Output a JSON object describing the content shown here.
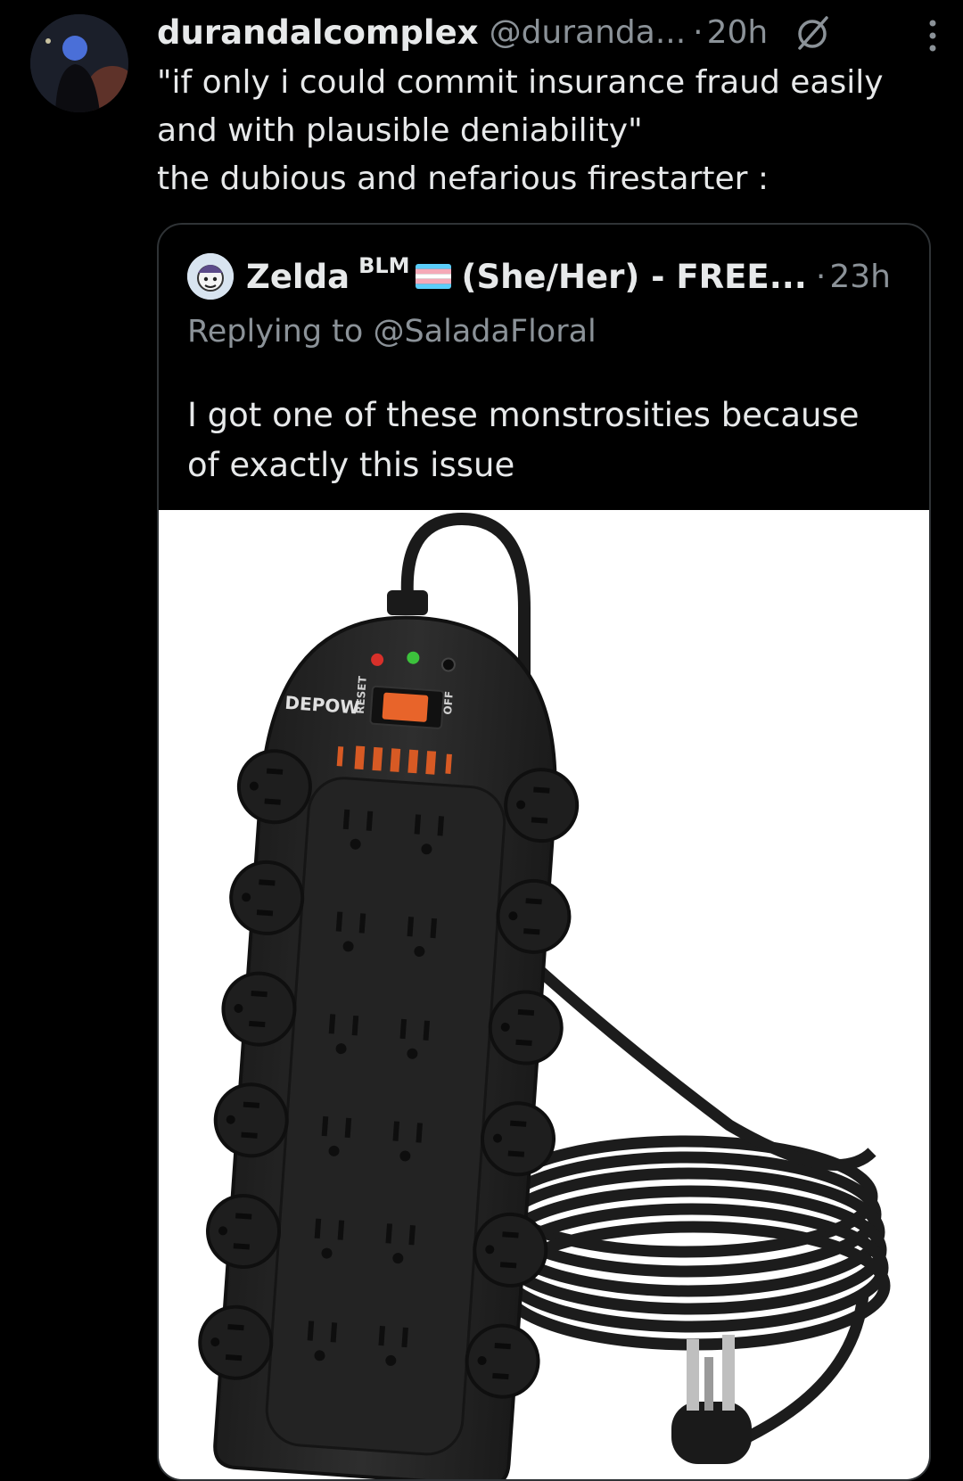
{
  "tweet": {
    "display_name": "durandalcomplex",
    "handle": "@duranda...",
    "separator": "·",
    "time": "20h",
    "lines": [
      "\"if only i could commit insurance fraud easily",
      "and with plausible deniability\"",
      "the dubious and nefarious firestarter :"
    ],
    "icons": {
      "avatar": "user-avatar",
      "reply_restricted": "no-reply-icon",
      "more": "more-options-icon"
    }
  },
  "quote": {
    "name_part1": "Zelda",
    "superscript": "BLM",
    "name_part2": "(She/Her) - FREE...",
    "separator": "·",
    "time": "23h",
    "replying_to": "Replying to @SaladaFloral",
    "lines": [
      "I got one of these monstrosities because",
      "of exactly this issue"
    ],
    "flag_icon": "transgender-flag-emoji",
    "media": {
      "brand": "DEPOW",
      "switch_left": "RESET",
      "switch_right": "OFF"
    }
  }
}
